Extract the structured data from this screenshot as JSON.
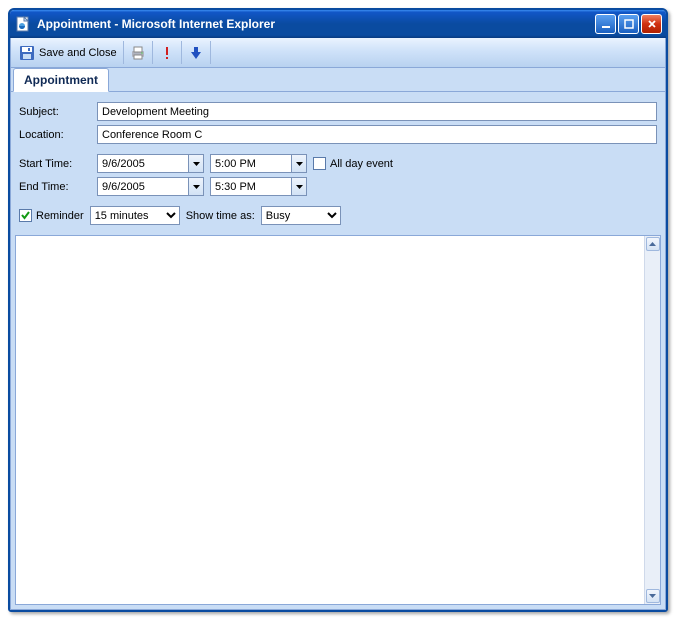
{
  "window": {
    "title": "Appointment - Microsoft Internet Explorer"
  },
  "toolbar": {
    "save_close_label": "Save and Close"
  },
  "tabs": {
    "appointment_label": "Appointment"
  },
  "form": {
    "subject_label": "Subject:",
    "subject_value": "Development Meeting",
    "location_label": "Location:",
    "location_value": "Conference Room C",
    "start_label": "Start Time:",
    "start_date": "9/6/2005",
    "start_time": "5:00 PM",
    "end_label": "End Time:",
    "end_date": "9/6/2005",
    "end_time": "5:30 PM",
    "allday_label": "All day event",
    "allday_checked": false,
    "reminder_label": "Reminder",
    "reminder_checked": true,
    "reminder_value": "15 minutes",
    "showas_label": "Show time as:",
    "showas_value": "Busy"
  }
}
